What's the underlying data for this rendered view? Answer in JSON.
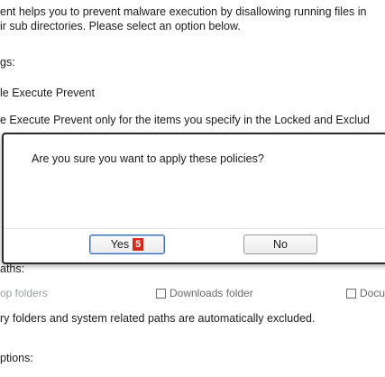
{
  "background": {
    "description_line1": "ent helps you to prevent malware execution by disallowing running files in",
    "description_line2": "ir sub directories. Please select an option below.",
    "settings_heading": "gs:",
    "option_disable": "le Execute Prevent",
    "option_enable_locked": "e Execute Prevent only for the items you specify in the Locked and Exclud",
    "paths_heading": "aths:",
    "excluded_note": "ry folders and system related paths are automatically excluded.",
    "options_heading": "ptions:"
  },
  "checkboxes": [
    {
      "label": "op folders",
      "checked": false,
      "greyed": true
    },
    {
      "label": "Downloads folder",
      "checked": false,
      "greyed": false
    },
    {
      "label": "Docu",
      "checked": false,
      "greyed": false
    }
  ],
  "dialog": {
    "message": "Are you sure you want to apply these policies?",
    "yes_label": "Yes",
    "yes_badge": "5",
    "no_label": "No"
  },
  "colors": {
    "badge": "#d42b1e",
    "focus_border": "#3c6fb3"
  }
}
